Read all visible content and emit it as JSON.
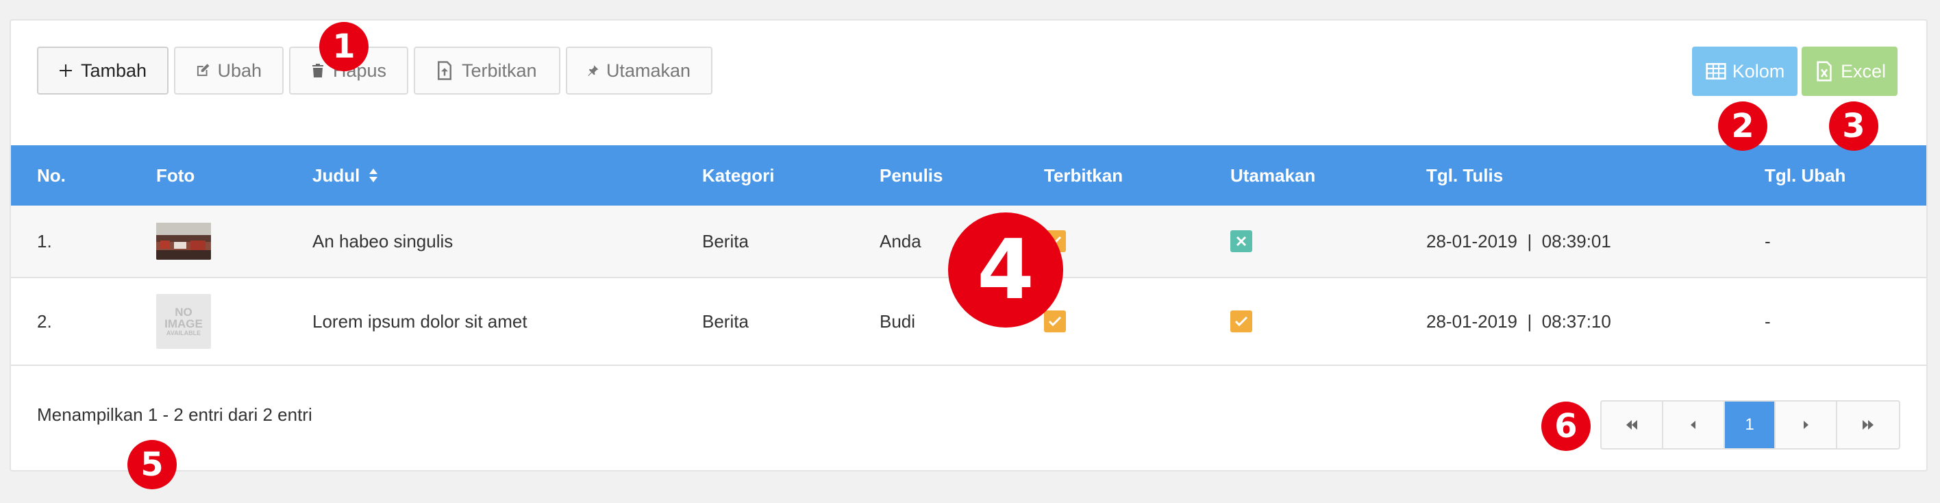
{
  "toolbar": {
    "tambah": "Tambah",
    "ubah": "Ubah",
    "hapus": "Hapus",
    "terbitkan": "Terbitkan",
    "utamakan": "Utamakan",
    "kolom": "Kolom",
    "excel": "Excel"
  },
  "table": {
    "headers": {
      "no": "No.",
      "foto": "Foto",
      "judul": "Judul",
      "kategori": "Kategori",
      "penulis": "Penulis",
      "terbitkan": "Terbitkan",
      "utamakan": "Utamakan",
      "tgl_tulis": "Tgl. Tulis",
      "tgl_ubah": "Tgl. Ubah"
    },
    "rows": [
      {
        "no": "1.",
        "foto": "photo",
        "judul": "An habeo singulis",
        "kategori": "Berita",
        "penulis": "Anda",
        "terbitkan": true,
        "utamakan": false,
        "tgl_tulis": "28-01-2019  |  08:39:01",
        "tgl_ubah": "-"
      },
      {
        "no": "2.",
        "foto": "no-image",
        "judul": "Lorem ipsum dolor sit amet",
        "kategori": "Berita",
        "penulis": "Budi",
        "terbitkan": true,
        "utamakan": true,
        "tgl_tulis": "28-01-2019  |  08:37:10",
        "tgl_ubah": "-"
      }
    ],
    "no_image_line1": "NO",
    "no_image_line2": "IMAGE",
    "no_image_line3": "AVAILABLE"
  },
  "footer": {
    "info": "Menampilkan 1 - 2 entri dari 2 entri",
    "current_page": "1"
  },
  "callouts": [
    "1",
    "2",
    "3",
    "4",
    "5",
    "6"
  ],
  "colors": {
    "header": "#4a97e8",
    "kolom": "#7bc3f1",
    "excel": "#a9d88a",
    "check_on": "#f3ad3c",
    "check_off": "#5bbfae",
    "callout": "#e60012"
  }
}
